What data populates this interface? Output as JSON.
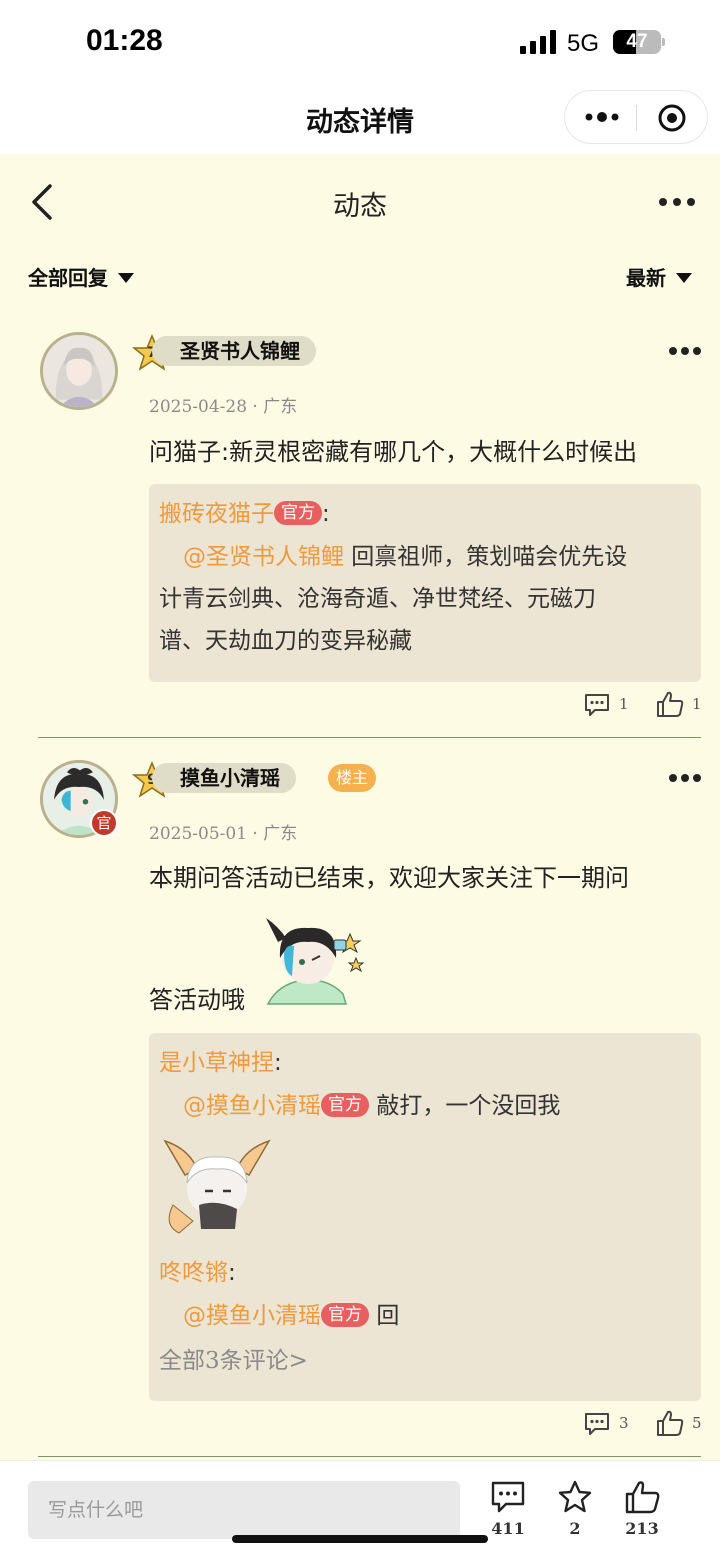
{
  "status_bar": {
    "time": "01:28",
    "network": "5G",
    "battery": "47",
    "battery_level": 0.47
  },
  "mp_header": {
    "title": "动态详情"
  },
  "nav": {
    "title": "动态"
  },
  "filters": {
    "left": "全部回复",
    "right": "最新"
  },
  "comments": [
    {
      "level": "7",
      "name": "圣贤书人锦鲤",
      "meta": "2025-04-28 · 广东",
      "text": "问猫子:新灵根密藏有哪几个，大概什么时候出",
      "reply": {
        "author": "搬砖夜猫子",
        "tag": "官方",
        "mention": "@圣贤书人锦鲤",
        "text_line1": " 回禀祖师，策划喵会优先设",
        "text_line2": "计青云剑典、沧海奇遁、净世梵经、元磁刀",
        "text_line3": "谱、天劫血刀的变异秘藏"
      },
      "comment_count": "1",
      "like_count": "1"
    },
    {
      "level": "9",
      "name": "摸鱼小清瑶",
      "owner_badge": "楼主",
      "gov_badge": "官",
      "meta": "2025-05-01 · 广东",
      "text_line1": "本期问答活动已结束，欢迎大家关注下一期问",
      "text_line2": "答活动哦",
      "replies": [
        {
          "author": "是小草神捏",
          "mention": "@摸鱼小清瑶",
          "tag": "官方",
          "text": "敲打，一个没回我"
        },
        {
          "author": "咚咚锵",
          "mention": "@摸鱼小清瑶",
          "tag": "官方",
          "text": "回"
        }
      ],
      "all_comments_link": "全部3条评论>",
      "comment_count": "3",
      "like_count": "5"
    }
  ],
  "bottom_bar": {
    "input_placeholder": "写点什么吧",
    "comments": "411",
    "favorites": "2",
    "likes": "213"
  },
  "colors": {
    "page_bg": "#fdfbe3",
    "reply_bg": "#ece5d3",
    "mention": "#f09a3e",
    "official_tag": "#e75f5f",
    "owner_tag": "#f6b14f"
  }
}
